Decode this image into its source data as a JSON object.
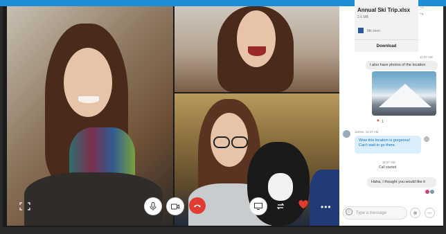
{
  "colors": {
    "accent": "#1e8fd6",
    "end_call": "#e23b32",
    "heart": "#e23b32",
    "outgoing_bubble": "#dbeefe"
  },
  "call": {
    "controls": [
      {
        "name": "fullscreen",
        "icon": "fullscreen-icon"
      },
      {
        "name": "microphone",
        "icon": "microphone-icon"
      },
      {
        "name": "video",
        "icon": "video-camera-icon"
      },
      {
        "name": "end_call",
        "icon": "phone-hangup-icon"
      },
      {
        "name": "share_screen",
        "icon": "share-screen-icon"
      },
      {
        "name": "transfer",
        "icon": "arrows-icon"
      },
      {
        "name": "react",
        "icon": "heart-icon"
      },
      {
        "name": "more",
        "icon": "more-icon"
      }
    ]
  },
  "chat": {
    "file": {
      "title": "Annual Ski Trip.xlsx",
      "size": "2.6 MB",
      "filename": "Mic.teon",
      "download_label": "Download"
    },
    "messages": [
      {
        "type": "timestamp",
        "text": "11:37 AM"
      },
      {
        "type": "outgoing",
        "text": "I also have photos of the location"
      },
      {
        "type": "reaction",
        "icon": "heart-icon",
        "count": "1"
      },
      {
        "type": "sender",
        "text": "James, 11:37 AM"
      },
      {
        "type": "incoming",
        "text": "Wow this location is gorgeous! Can't wait to go there."
      },
      {
        "type": "timestamp",
        "text": "11:37 AM"
      },
      {
        "type": "system",
        "text": "Call started"
      },
      {
        "type": "outgoing",
        "text": "Haha, I thought you would like it"
      }
    ],
    "composer": {
      "placeholder": "Type a message"
    }
  }
}
